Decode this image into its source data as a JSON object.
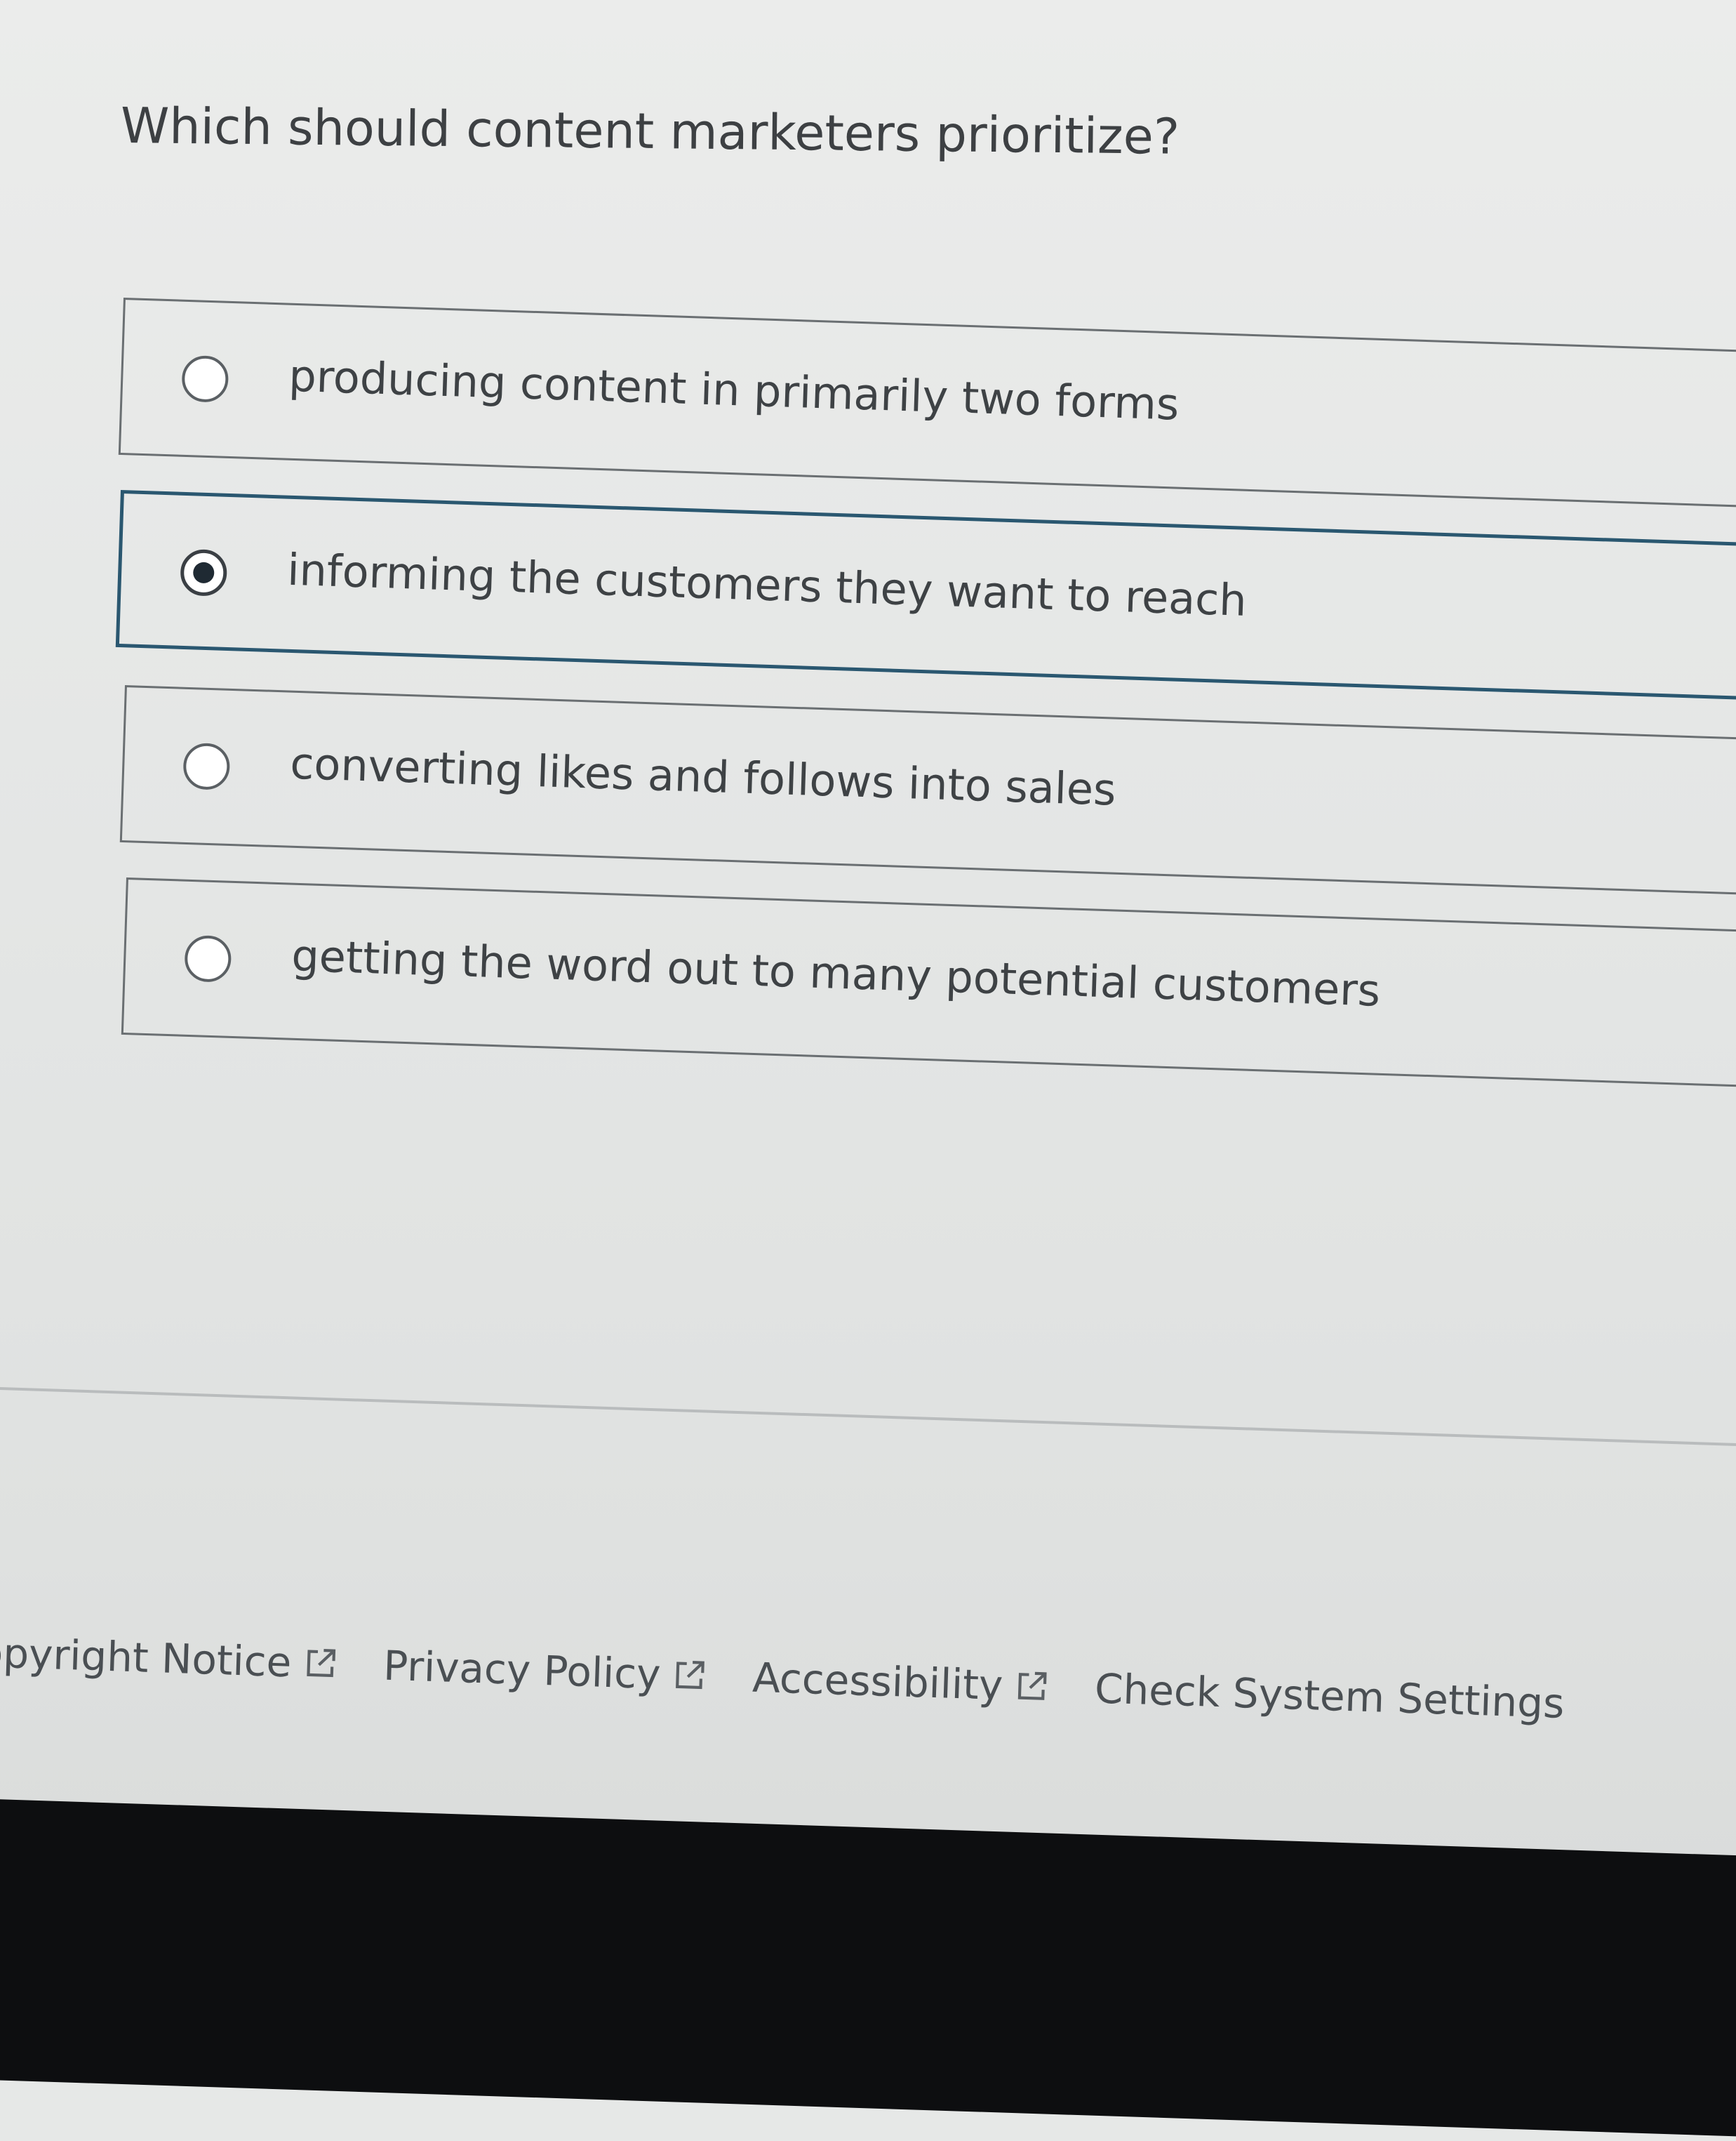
{
  "question": {
    "text": "Which should content marketers prioritize?"
  },
  "options": [
    {
      "label": "producing content in primarily two forms",
      "selected": false
    },
    {
      "label": "informing the customers they want to reach",
      "selected": true
    },
    {
      "label": "converting likes and follows into sales",
      "selected": false
    },
    {
      "label": "getting the word out to many potential customers",
      "selected": false
    }
  ],
  "footer": {
    "links": [
      {
        "label": "opyright Notice",
        "external": true
      },
      {
        "label": "Privacy Policy",
        "external": true
      },
      {
        "label": "Accessibility",
        "external": true
      },
      {
        "label": "Check System Settings",
        "external": false
      }
    ]
  },
  "colors": {
    "selected_border": "#2a5770",
    "text": "#3e4245",
    "bezel": "#0d0e10"
  },
  "icons": {
    "external_link": "external-link-icon",
    "radio_unselected": "radio-empty-icon",
    "radio_selected": "radio-filled-icon"
  }
}
